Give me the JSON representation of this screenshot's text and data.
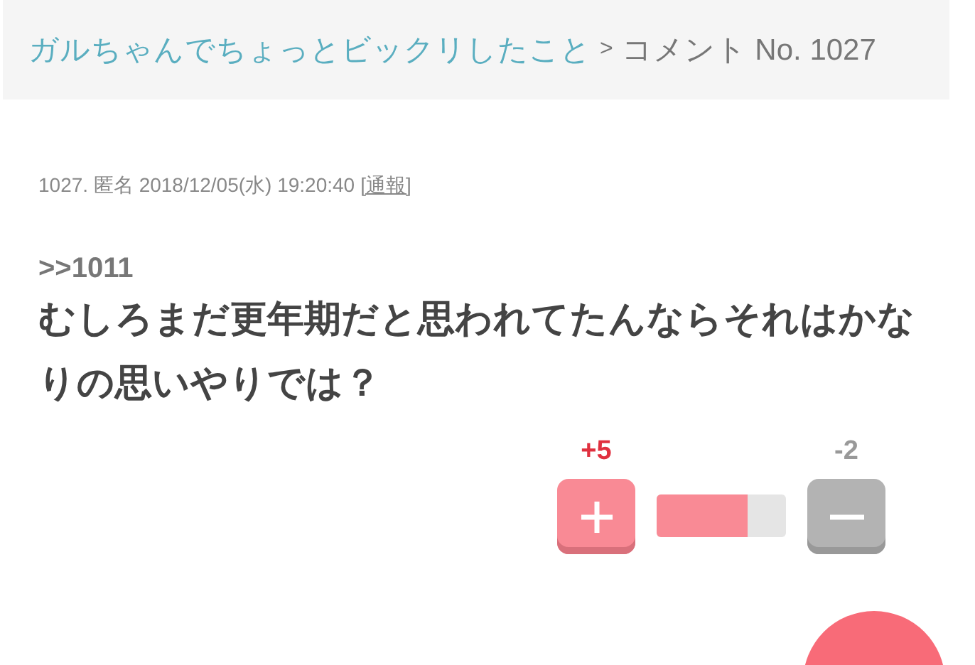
{
  "breadcrumb": {
    "link": "ガルちゃんでちょっとビックリしたこと",
    "separator": ">",
    "current": "コメント No. 1027"
  },
  "comment": {
    "meta": "1027. 匿名 2018/12/05(水) 19:20:40",
    "report_link": "[通報]",
    "reply_to": ">>1011",
    "body": "むしろまだ更年期だと思われてたんならそれはかなりの思いやりでは？"
  },
  "votes": {
    "plus_count": "+5",
    "minus_count": "-2",
    "level": 0.7
  }
}
